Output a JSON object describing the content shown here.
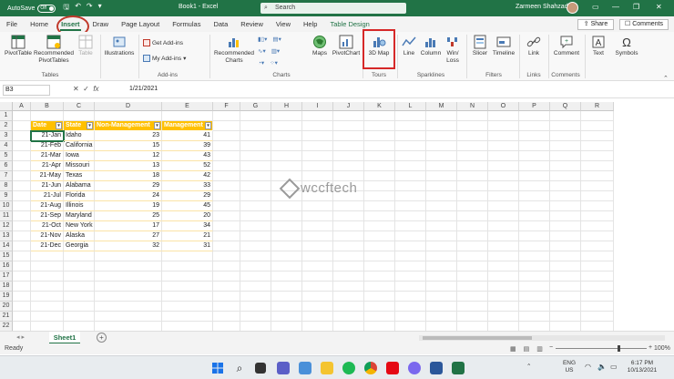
{
  "titlebar": {
    "autosave_label": "AutoSave",
    "autosave_state": "Off",
    "doc_title": "Book1  -  Excel",
    "search_placeholder": "Search",
    "user_name": "Zarmeen Shahzad"
  },
  "tabs": [
    "File",
    "Home",
    "Insert",
    "Draw",
    "Page Layout",
    "Formulas",
    "Data",
    "Review",
    "View",
    "Help",
    "Table Design"
  ],
  "active_tab": "Insert",
  "share_label": "Share",
  "comments_label": "Comments",
  "ribbon": {
    "pivottable": "PivotTable",
    "recommended_pivottables": "Recommended PivotTables",
    "table": "Table",
    "illustrations": "Illustrations",
    "get_addins": "Get Add-ins",
    "my_addins": "My Add-ins",
    "recommended_charts": "Recommended Charts",
    "maps": "Maps",
    "pivotchart": "PivotChart",
    "map3d": "3D Map",
    "line": "Line",
    "column": "Column",
    "winloss": "Win/ Loss",
    "slicer": "Slicer",
    "timeline": "Timeline",
    "link": "Link",
    "comment": "Comment",
    "text": "Text",
    "symbols": "Symbols",
    "groups": {
      "tables": "Tables",
      "addins": "Add-ins",
      "charts": "Charts",
      "tours": "Tours",
      "sparklines": "Sparklines",
      "filters": "Filters",
      "links": "Links",
      "comments": "Comments"
    }
  },
  "formula_bar": {
    "name_box": "B3",
    "fx": "fx",
    "value": "1/21/2021"
  },
  "columns": [
    "A",
    "B",
    "C",
    "D",
    "E",
    "F",
    "G",
    "H",
    "I",
    "J",
    "K",
    "L",
    "M",
    "N",
    "O",
    "P",
    "Q",
    "R"
  ],
  "rows": [
    "1",
    "2",
    "3",
    "4",
    "5",
    "6",
    "7",
    "8",
    "9",
    "10",
    "11",
    "12",
    "13",
    "14",
    "15",
    "16",
    "17",
    "18",
    "19",
    "20",
    "21",
    "22"
  ],
  "table": {
    "headers": [
      "Date",
      "State",
      "Non-Management",
      "Management"
    ],
    "data": [
      [
        "21-Jan",
        "Idaho",
        "23",
        "41"
      ],
      [
        "21-Feb",
        "California",
        "15",
        "39"
      ],
      [
        "21-Mar",
        "Iowa",
        "12",
        "43"
      ],
      [
        "21-Apr",
        "Missouri",
        "13",
        "52"
      ],
      [
        "21-May",
        "Texas",
        "18",
        "42"
      ],
      [
        "21-Jun",
        "Alabama",
        "29",
        "33"
      ],
      [
        "21-Jul",
        "Florida",
        "24",
        "29"
      ],
      [
        "21-Aug",
        "Illinois",
        "19",
        "45"
      ],
      [
        "21-Sep",
        "Maryland",
        "25",
        "20"
      ],
      [
        "21-Oct",
        "New York",
        "17",
        "34"
      ],
      [
        "21-Nov",
        "Alaska",
        "27",
        "21"
      ],
      [
        "21-Dec",
        "Georgia",
        "32",
        "31"
      ]
    ]
  },
  "watermark": "wccftech",
  "sheet_tab": "Sheet1",
  "status": "Ready",
  "zoom": "100%",
  "taskbar": {
    "lang": "ENG",
    "region": "US",
    "time": "6:17 PM",
    "date": "10/13/2021"
  },
  "colors": {
    "excel_green": "#217346",
    "table_header": "#ffc000",
    "highlight_red": "#d62828"
  }
}
